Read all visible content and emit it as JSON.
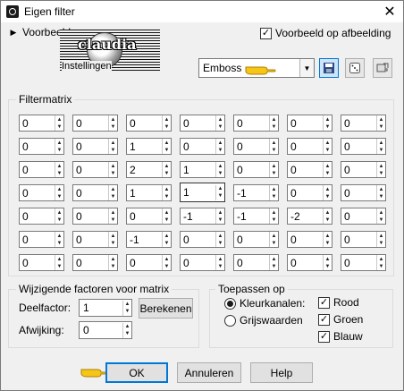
{
  "window": {
    "title": "Eigen filter",
    "close_glyph": "✕"
  },
  "preview": {
    "toggle_label": "Voorbeeld",
    "checkbox_label": "Voorbeeld op afbeelding",
    "checked": true
  },
  "logo": {
    "word": "claudia"
  },
  "settings": {
    "label": "Instellingen",
    "preset_value": "Emboss"
  },
  "icons": {
    "save": "floppy-disk-icon",
    "random": "dice-icon",
    "reset": "reset-icon",
    "pointer": "hand-pointer-icon"
  },
  "matrix": {
    "title": "Filtermatrix",
    "rows": [
      [
        "0",
        "0",
        "0",
        "0",
        "0",
        "0",
        "0"
      ],
      [
        "0",
        "0",
        "1",
        "0",
        "0",
        "0",
        "0"
      ],
      [
        "0",
        "0",
        "2",
        "1",
        "0",
        "0",
        "0"
      ],
      [
        "0",
        "0",
        "1",
        "1",
        "-1",
        "0",
        "0"
      ],
      [
        "0",
        "0",
        "0",
        "-1",
        "-1",
        "-2",
        "0"
      ],
      [
        "0",
        "0",
        "-1",
        "0",
        "0",
        "0",
        "0"
      ],
      [
        "0",
        "0",
        "0",
        "0",
        "0",
        "0",
        "0"
      ]
    ]
  },
  "factors": {
    "title": "Wijzigende factoren voor matrix",
    "divisor_label": "Deelfactor:",
    "divisor_value": "1",
    "compute_label": "Berekenen",
    "bias_label": "Afwijking:",
    "bias_value": "0"
  },
  "apply": {
    "title": "Toepassen op",
    "color_channels_label": "Kleurkanalen:",
    "grayscale_label": "Grijswaarden",
    "red_label": "Rood",
    "green_label": "Groen",
    "blue_label": "Blauw"
  },
  "buttons": {
    "ok": "OK",
    "cancel": "Annuleren",
    "help": "Help"
  },
  "colors": {
    "accent": "#0078d7",
    "pointer": "#f5c518"
  }
}
